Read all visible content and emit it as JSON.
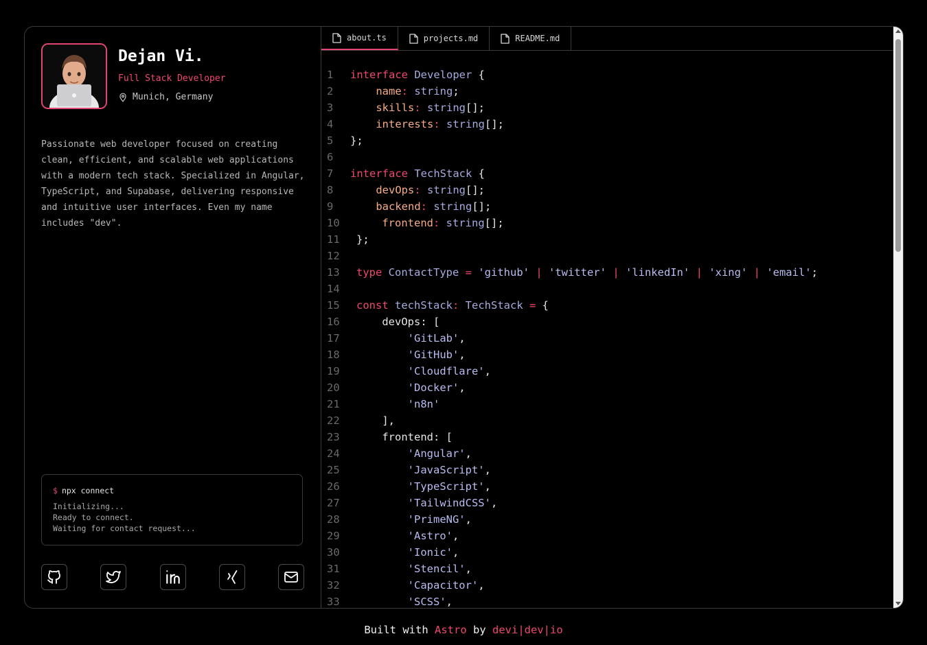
{
  "profile": {
    "name": "Dejan Vi.",
    "role": "Full Stack Developer",
    "location": "Munich, Germany",
    "bio": "Passionate web developer focused on creating clean, efficient, and scalable web applications with a modern tech stack. Specialized in Angular, TypeScript, and Supabase, delivering responsive and intuitive user interfaces. Even my name includes \"dev\"."
  },
  "terminal": {
    "prompt": "$",
    "command": "npx connect",
    "output": [
      "Initializing...",
      "Ready to connect.",
      "Waiting for contact request..."
    ]
  },
  "social": [
    {
      "name": "github",
      "icon": "github-icon"
    },
    {
      "name": "twitter",
      "icon": "twitter-icon"
    },
    {
      "name": "linkedin",
      "icon": "linkedin-icon"
    },
    {
      "name": "xing",
      "icon": "xing-icon"
    },
    {
      "name": "email",
      "icon": "mail-icon"
    }
  ],
  "tabs": [
    {
      "label": "about.ts",
      "active": true
    },
    {
      "label": "projects.md",
      "active": false
    },
    {
      "label": "README.md",
      "active": false
    }
  ],
  "code_lines": [
    [
      [
        "k",
        "interface "
      ],
      [
        "t",
        "Developer"
      ],
      [
        "w",
        " {"
      ]
    ],
    [
      [
        "p",
        "    name"
      ],
      [
        "k",
        ": "
      ],
      [
        "t",
        "string"
      ],
      [
        "w",
        ";"
      ]
    ],
    [
      [
        "p",
        "    skills"
      ],
      [
        "k",
        ": "
      ],
      [
        "t",
        "string"
      ],
      [
        "w",
        "[];"
      ]
    ],
    [
      [
        "p",
        "    interests"
      ],
      [
        "k",
        ": "
      ],
      [
        "t",
        "string"
      ],
      [
        "w",
        "[];"
      ]
    ],
    [
      [
        "w",
        "};"
      ]
    ],
    [],
    [
      [
        "k",
        "interface "
      ],
      [
        "t",
        "TechStack"
      ],
      [
        "w",
        " {"
      ]
    ],
    [
      [
        "p",
        "    devOps"
      ],
      [
        "k",
        ": "
      ],
      [
        "t",
        "string"
      ],
      [
        "w",
        "[];"
      ]
    ],
    [
      [
        "p",
        "    backend"
      ],
      [
        "k",
        ": "
      ],
      [
        "t",
        "string"
      ],
      [
        "w",
        "[];"
      ]
    ],
    [
      [
        "p",
        "    frontend"
      ],
      [
        "k",
        ": "
      ],
      [
        "t",
        "string"
      ],
      [
        "w",
        "[];"
      ]
    ],
    [
      [
        "w",
        "};"
      ]
    ],
    [],
    [
      [
        "k",
        "type "
      ],
      [
        "t",
        "ContactType"
      ],
      [
        "k",
        " = "
      ],
      [
        "s",
        "'github'"
      ],
      [
        "k",
        " | "
      ],
      [
        "s",
        "'twitter'"
      ],
      [
        "k",
        " | "
      ],
      [
        "s",
        "'linkedIn'"
      ],
      [
        "k",
        " | "
      ],
      [
        "s",
        "'xing'"
      ],
      [
        "k",
        " | "
      ],
      [
        "s",
        "'email'"
      ],
      [
        "w",
        ";"
      ]
    ],
    [],
    [
      [
        "k",
        "const "
      ],
      [
        "t",
        "techStack"
      ],
      [
        "k",
        ": "
      ],
      [
        "t",
        "TechStack"
      ],
      [
        "k",
        " = "
      ],
      [
        "w",
        "{"
      ]
    ],
    [
      [
        "w",
        "    devOps: ["
      ]
    ],
    [
      [
        "s",
        "        'GitLab'"
      ],
      [
        "w",
        ","
      ]
    ],
    [
      [
        "s",
        "        'GitHub'"
      ],
      [
        "w",
        ","
      ]
    ],
    [
      [
        "s",
        "        'Cloudflare'"
      ],
      [
        "w",
        ","
      ]
    ],
    [
      [
        "s",
        "        'Docker'"
      ],
      [
        "w",
        ","
      ]
    ],
    [
      [
        "s",
        "        'n8n'"
      ]
    ],
    [
      [
        "w",
        "    ],"
      ]
    ],
    [
      [
        "w",
        "    frontend: ["
      ]
    ],
    [
      [
        "s",
        "        'Angular'"
      ],
      [
        "w",
        ","
      ]
    ],
    [
      [
        "s",
        "        'JavaScript'"
      ],
      [
        "w",
        ","
      ]
    ],
    [
      [
        "s",
        "        'TypeScript'"
      ],
      [
        "w",
        ","
      ]
    ],
    [
      [
        "s",
        "        'TailwindCSS'"
      ],
      [
        "w",
        ","
      ]
    ],
    [
      [
        "s",
        "        'PrimeNG'"
      ],
      [
        "w",
        ","
      ]
    ],
    [
      [
        "s",
        "        'Astro'"
      ],
      [
        "w",
        ","
      ]
    ],
    [
      [
        "s",
        "        'Ionic'"
      ],
      [
        "w",
        ","
      ]
    ],
    [
      [
        "s",
        "        'Stencil'"
      ],
      [
        "w",
        ","
      ]
    ],
    [
      [
        "s",
        "        'Capacitor'"
      ],
      [
        "w",
        ","
      ]
    ],
    [
      [
        "s",
        "        'SCSS'"
      ],
      [
        "w",
        ","
      ]
    ]
  ],
  "footer": {
    "prefix": "Built with ",
    "framework": "Astro",
    "middle": " by ",
    "author": "devi|dev|io"
  },
  "colors": {
    "accent": "#f0476f",
    "background": "#000000",
    "type": "#a6acdf",
    "property": "#f5ab85"
  }
}
